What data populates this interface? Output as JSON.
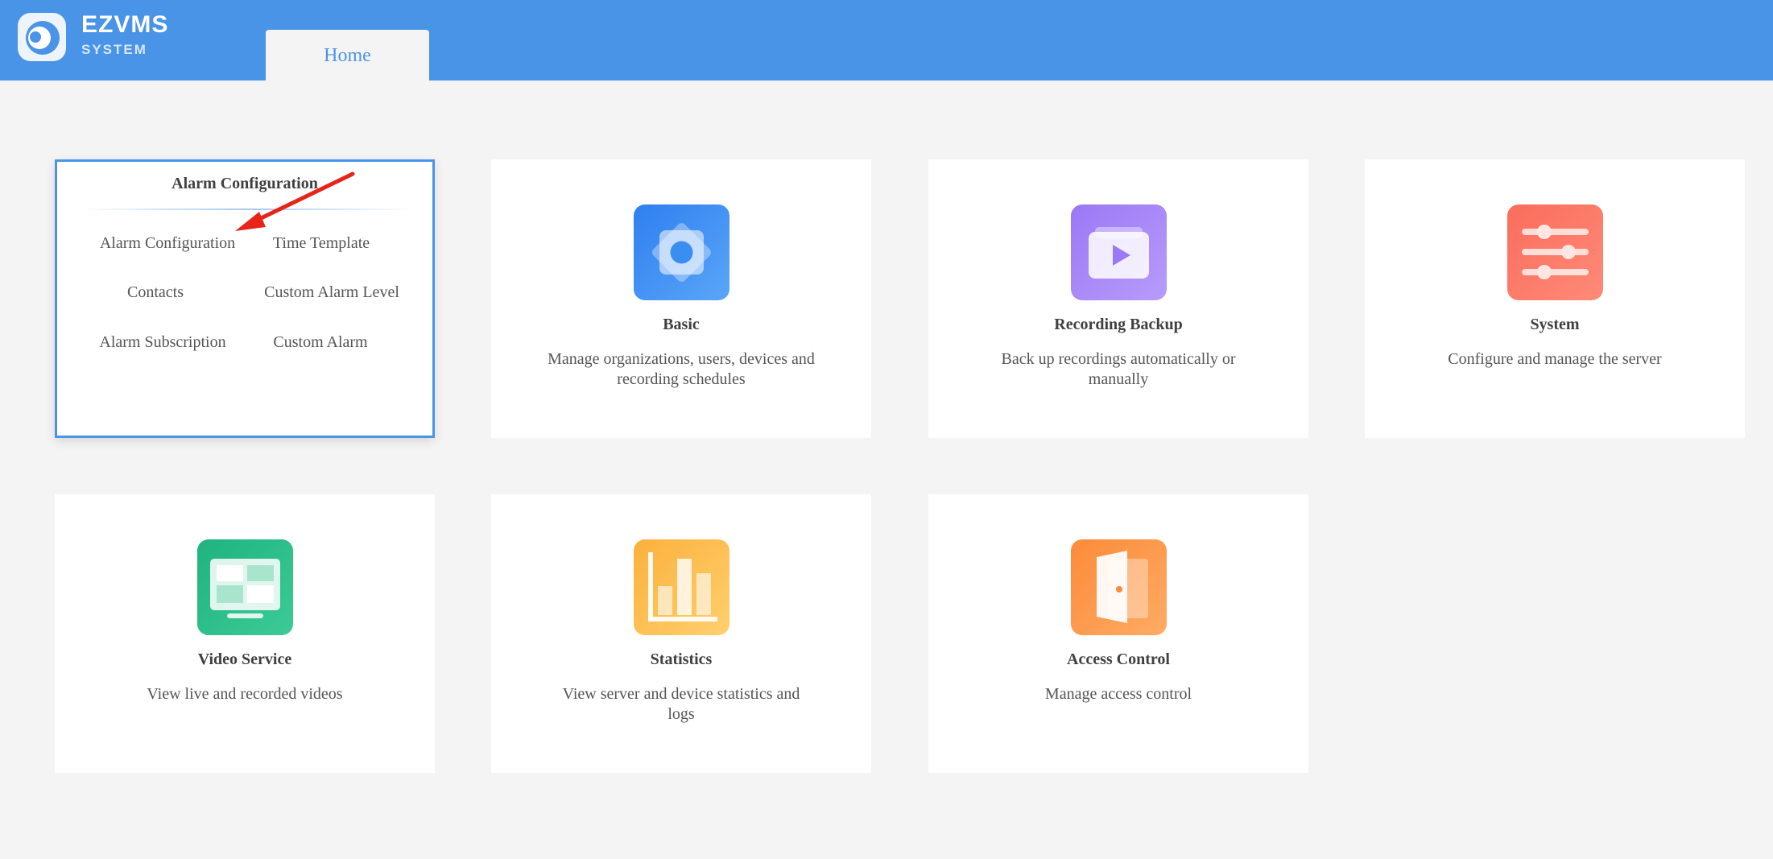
{
  "header": {
    "brand": "EZVMS",
    "brand_sub": "SYSTEM",
    "tab_home": "Home",
    "color": "#4a94e8"
  },
  "alarm_card": {
    "title": "Alarm Configuration",
    "links": [
      "Alarm Configuration",
      "Time Template",
      "Contacts",
      "Custom Alarm Level",
      "Alarm Subscription",
      "Custom Alarm"
    ]
  },
  "cards": {
    "basic": {
      "title": "Basic",
      "desc": "Manage organizations, users, devices and recording schedules",
      "icon": "gear-icon"
    },
    "recording_backup": {
      "title": "Recording Backup",
      "desc": "Back up recordings automatically or manually",
      "icon": "play-icon"
    },
    "system": {
      "title": "System",
      "desc": "Configure and manage the server",
      "icon": "sliders-icon"
    },
    "video_service": {
      "title": "Video Service",
      "desc": "View live and recorded videos",
      "icon": "monitor-icon"
    },
    "statistics": {
      "title": "Statistics",
      "desc": "View server and device statistics and logs",
      "icon": "bar-chart-icon"
    },
    "access_control": {
      "title": "Access Control",
      "desc": "Manage access control",
      "icon": "door-icon"
    }
  }
}
